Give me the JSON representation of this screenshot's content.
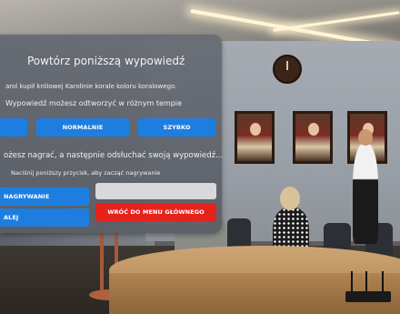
{
  "panel": {
    "title": "Powtórz poniższą wypowiedź",
    "sentence": "arol kupił królowej Karolinie korale koloru koralowego.",
    "speed_label": "Wypowiedź możesz odtworzyć w różnym tempie",
    "speed_buttons": {
      "slow": "",
      "normal": "NORMALNIE",
      "fast": "SZYBKO"
    },
    "record_label": "ożesz nagrać, a następnie odsłuchać swoją wypowiedź...",
    "record_hint": "Naciśnij poniższy przycisk, aby zacząć nagrywanie",
    "record_button": "NAGRYWANIE",
    "next_button": "ALEJ",
    "menu_button": "WRÓĆ DO MENU GŁÓWNEGO"
  },
  "colors": {
    "button_blue": "#1e7ee0",
    "button_red": "#e5231d",
    "panel_bg": "#686c74"
  }
}
